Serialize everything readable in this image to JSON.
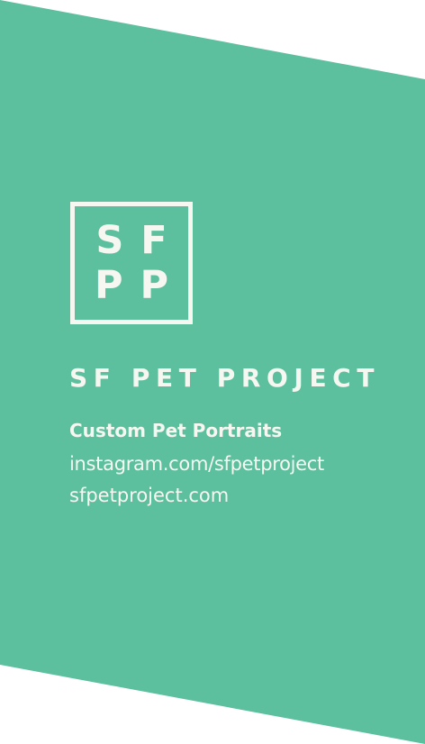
{
  "colors": {
    "background": "#ffffff",
    "card": "#5cc09f",
    "text": "#f7f7f2"
  },
  "logo": {
    "line1": "SF",
    "line2": "PP"
  },
  "brand": {
    "name": "SF PET PROJECT",
    "tagline": "Custom Pet Portraits"
  },
  "links": {
    "instagram": "instagram.com/sfpetproject",
    "website": "sfpetproject.com"
  }
}
